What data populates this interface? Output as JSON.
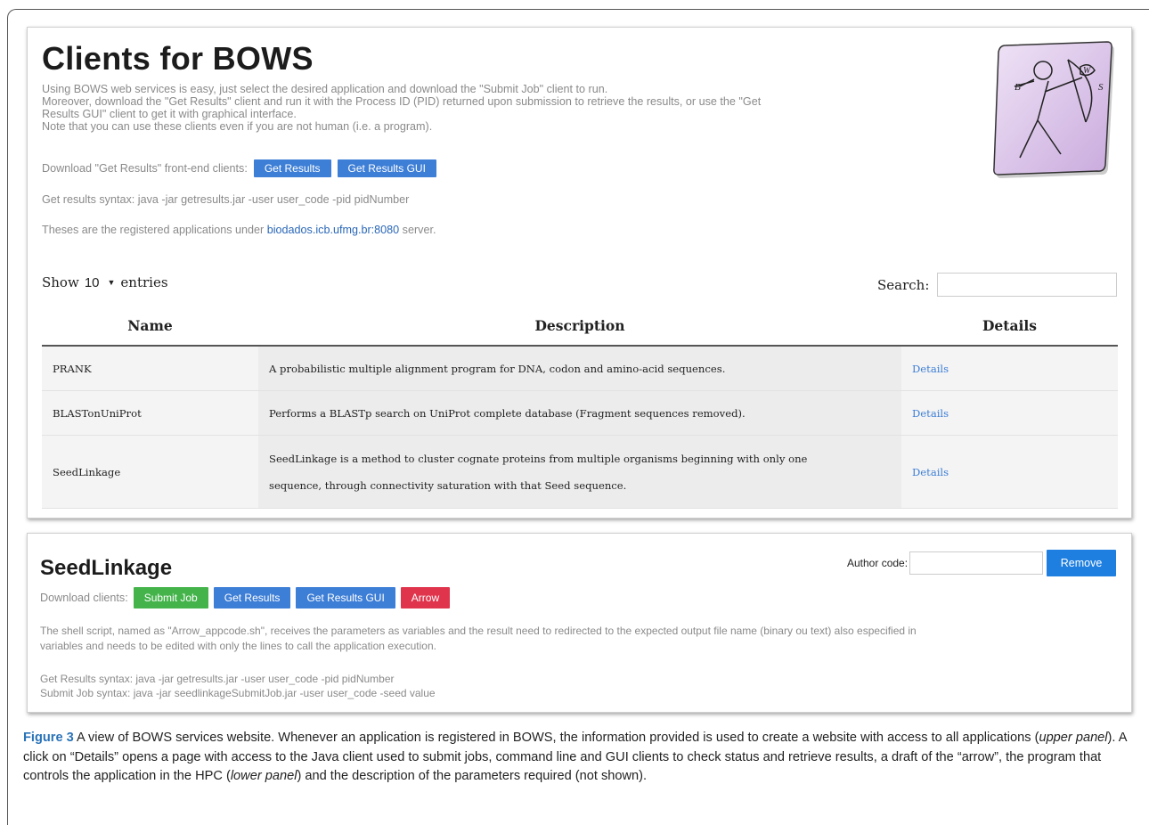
{
  "upper": {
    "title": "Clients for BOWS",
    "intro": [
      "Using BOWS web services is easy, just select the desired application and download the \"Submit Job\" client to run.",
      "Moreover, download the \"Get Results\" client and run it with the Process ID (PID) returned upon submission to retrieve the results, or use the \"Get",
      "Results GUI\" client to get it with graphical interface.",
      "Note that you can use these clients even if you are not human (i.e. a program)."
    ],
    "download_label": "Download \"Get Results\" front-end clients:",
    "btn_get_results": "Get Results",
    "btn_get_results_gui": "Get Results GUI",
    "syntax": "Get results syntax: java -jar getresults.jar -user user_code -pid pidNumber",
    "registered_pre": "Theses are the registered applications under ",
    "registered_link": "biodados.icb.ufmg.br:8080",
    "registered_post": " server.",
    "logo": {
      "letters": [
        "B",
        "W",
        "S"
      ],
      "bg": "#d9c2e8"
    },
    "show_label": "Show",
    "show_value": "10",
    "entries_label": "entries",
    "search_label": "Search:",
    "table": {
      "headers": [
        "Name",
        "Description",
        "Details"
      ],
      "rows": [
        {
          "name": "PRANK",
          "description": "A probabilistic multiple alignment program for DNA, codon and amino-acid sequences.",
          "details": "Details"
        },
        {
          "name": "BLASTonUniProt",
          "description": "Performs a BLASTp search on UniProt complete database (Fragment sequences removed).",
          "details": "Details"
        },
        {
          "name": "SeedLinkage",
          "description_1": "SeedLinkage is a method to cluster cognate proteins from multiple organisms beginning with only one",
          "description_2": "sequence, through connectivity saturation with that Seed sequence.",
          "details": "Details"
        }
      ]
    }
  },
  "lower": {
    "title": "SeedLinkage",
    "author_label": "Author code:",
    "remove": "Remove",
    "download_label": "Download clients:",
    "btn_submit": "Submit Job",
    "btn_get_results": "Get Results",
    "btn_get_results_gui": "Get Results GUI",
    "btn_arrow": "Arrow",
    "desc_1": "The shell script, named as \"Arrow_appcode.sh\", receives the parameters as variables and the result need to redirected to the expected output file name (binary ou text) also especified in",
    "desc_2": "variables and needs to be edited with only the lines to call the application execution.",
    "syntax_1": "Get Results syntax: java -jar getresults.jar -user user_code -pid pidNumber",
    "syntax_2": "Submit Job syntax: java -jar seedlinkageSubmitJob.jar -user user_code -seed value"
  },
  "caption": {
    "fig": "Figure 3",
    "text_1": "  A view of BOWS services website. Whenever an application is registered in BOWS, the information provided is used to create a website with access to all applications (",
    "em_1": "upper panel",
    "text_2": "). A click on “Details” opens a page with access to the Java client used to submit jobs, command line and GUI clients to check status and retrieve results, a draft of the “arrow”, the program that controls the application in the HPC (",
    "em_2": "lower panel",
    "text_3": ") and the description of the parameters required (not shown)."
  }
}
